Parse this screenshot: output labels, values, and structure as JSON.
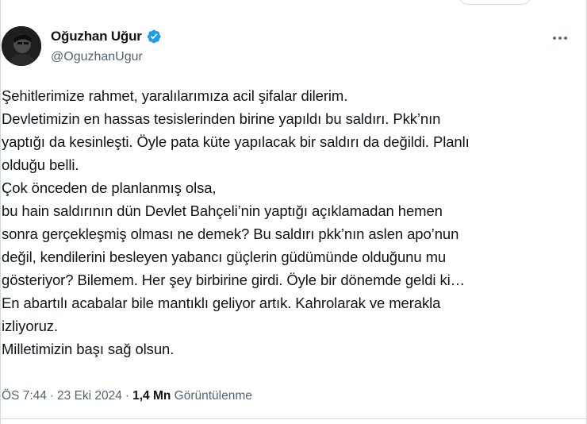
{
  "author": {
    "display_name": "Oğuzhan Uğur",
    "handle": "@OguzhanUgur",
    "verified": true,
    "verified_color": "#1d9bf0"
  },
  "tweet": {
    "lines": [
      "Şehitlerimize rahmet, yaralılarımıza acil şifalar dilerim.",
      "Devletimizin en hassas tesislerinden birine yapıldı bu saldırı. Pkk’nın",
      "yaptığı da kesinleşti. Öyle pata küte yapılacak bir saldırı da değildi. Planlı",
      "olduğu belli.",
      "Çok önceden de planlanmış olsa,",
      "bu hain saldırının dün Devlet Bahçeli’nin yaptığı açıklamadan hemen",
      "sonra gerçekleşmiş olması ne demek? Bu saldırı pkk’nın aslen apo’nun",
      "değil, kendilerini besleyen yabancı güçlerin güdümünde olduğunu mu",
      "gösteriyor? Bilemem. Her şey birbirine girdi. Öyle bir dönemde geldi ki…",
      "En abartılı acabalar bile mantıklı geliyor artık. Kahrolarak ve merakla",
      "izliyoruz.",
      "Milletimizin başı sağ olsun."
    ]
  },
  "meta": {
    "time": "ÖS 7:44",
    "separator": "·",
    "date": "23 Eki 2024",
    "views_count": "1,4 Mn",
    "views_label": "Görüntülenme"
  },
  "icons": {
    "more": "more-horizontal-icon",
    "verified": "verified-badge-icon",
    "avatar": "profile-avatar"
  }
}
